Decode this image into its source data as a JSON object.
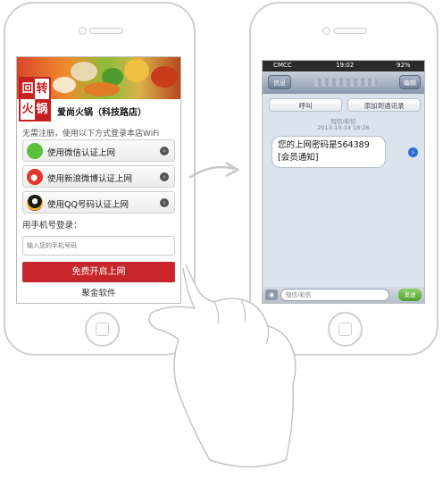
{
  "left_app": {
    "store_name": "爱尚火锅（科技路店）",
    "logo_chars": [
      "回",
      "转",
      "火",
      "锅"
    ],
    "login_hint": "无需注册，使用以下方式登录本店WiFi",
    "options": [
      {
        "label": "使用微信认证上网",
        "icon": "wechat-icon",
        "color": "#5bbf3a"
      },
      {
        "label": "使用新浪微博认证上网",
        "icon": "weibo-icon",
        "color": "#e0372f"
      },
      {
        "label": "使用QQ号码认证上网",
        "icon": "qq-icon",
        "color": "#1a1a1a"
      }
    ],
    "phone_login_label": "用手机号登录：",
    "phone_input_placeholder": "输入您的手机号码",
    "cta_label": "免费开启上网",
    "footer_brand": "聚金软件",
    "cta_color": "#c8262b"
  },
  "right_app": {
    "status": {
      "carrier": "CMCC",
      "time": "19:02",
      "battery": "92%"
    },
    "nav": {
      "back_label": "信息",
      "edit_label": "编辑"
    },
    "actions": {
      "call_label": "呼叫",
      "add_contact_label": "添加到通讯录"
    },
    "message_type": "短信/彩信",
    "timestamp": "2013-10-14 18:26",
    "message_lines": [
      "您的上网密码是564389",
      "[会员通知]"
    ],
    "composer_placeholder": "短信/彩信",
    "send_label": "发送"
  }
}
